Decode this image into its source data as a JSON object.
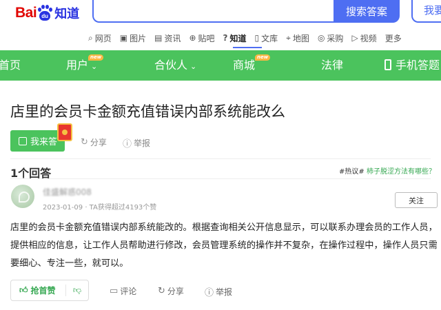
{
  "header": {
    "logo_bai": "Bai",
    "logo_du": "du",
    "logo_zhidao": "知道",
    "search_placeholder": "",
    "search_button": "搜索答案",
    "ask_button": "我要"
  },
  "subnav": {
    "items": [
      {
        "icon": "search-icon",
        "label": "网页"
      },
      {
        "icon": "image-icon",
        "label": "图片"
      },
      {
        "icon": "news-icon",
        "label": "资讯"
      },
      {
        "icon": "tieba-icon",
        "label": "贴吧"
      },
      {
        "icon": "zhidao-icon",
        "label": "知道",
        "active": true
      },
      {
        "icon": "wenku-icon",
        "label": "文库"
      },
      {
        "icon": "map-icon",
        "label": "地图"
      },
      {
        "icon": "purchase-icon",
        "label": "采购"
      },
      {
        "icon": "video-icon",
        "label": "视频"
      },
      {
        "icon": "",
        "label": "更多"
      }
    ]
  },
  "greennav": {
    "home": "首页",
    "user": "用户",
    "partner": "合伙人",
    "mall": "商城",
    "law": "法律",
    "mobile": "手机答题",
    "new_badge": "new"
  },
  "question": {
    "title": "店里的会员卡金额充值错误内部系统能改么",
    "answer_button": "我来答",
    "share": "分享",
    "report": "举报"
  },
  "answers_section": {
    "count_label": "1个回答",
    "hot_tag": "#热议#",
    "hot_link": "柿子脱涩方法有哪些？"
  },
  "answer": {
    "user_name": "佳盛解惑008",
    "date": "2023-01-09",
    "meta_suffix": "· TA获得超过4193个赞",
    "follow_button": "关注",
    "text": "店里的会员卡金额充值错误内部系统能改的。根据查询相关公开信息显示，可以联系办理会员的工作人员，提供相应的信息，让工作人员帮助进行修改，会员管理系统的操作并不复杂，在操作过程中，操作人员只需要细心、专注一些，就可以。",
    "like_label": "抢首赞",
    "comment": "评论",
    "share": "分享",
    "report": "举报"
  },
  "colors": {
    "brand_green": "#4bc35d",
    "search_blue": "#4e6ef2",
    "logo_red": "#e10602",
    "logo_blue": "#2932e1"
  }
}
